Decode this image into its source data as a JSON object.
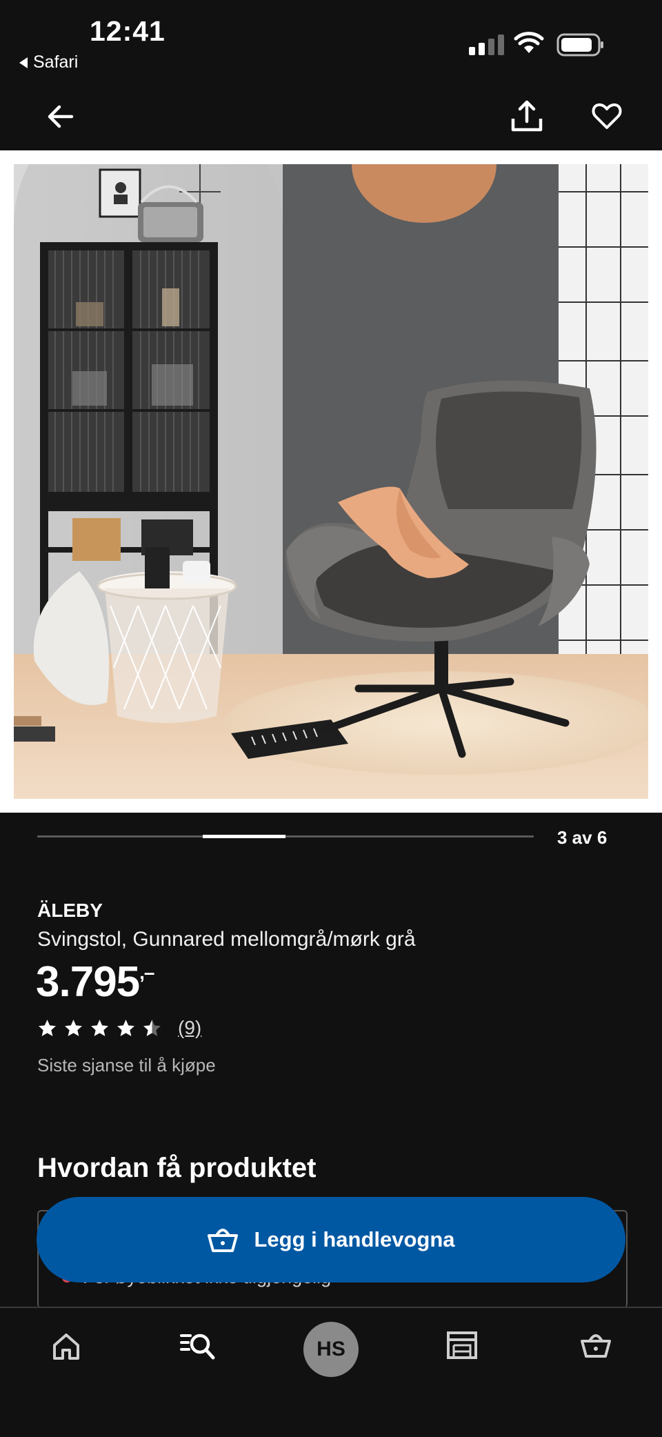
{
  "status_bar": {
    "time": "12:41",
    "back_app_label": "Safari"
  },
  "header": {
    "back_icon": "arrow-left-icon",
    "share_icon": "share-icon",
    "favorite_icon": "heart-icon"
  },
  "gallery": {
    "current_index": 3,
    "total": 6,
    "counter_text": "3 av 6",
    "progress_fraction": 0.5
  },
  "product": {
    "brand": "ÄLEBY",
    "description": "Svingstol, Gunnared mellomgrå/mørk grå",
    "price": "3.795",
    "price_suffix": ",–",
    "rating": 4.5,
    "rating_max": 5,
    "review_count_text": "(9)",
    "availability_note": "Siste sjanse til å kjøpe"
  },
  "availability": {
    "section_title": "Hvordan få produktet",
    "status_text": "For øyeblikket ikke tilgjengelig",
    "status_color": "#e0444e"
  },
  "cta": {
    "label": "Legg i handlevogna",
    "color": "#0058a3",
    "icon": "shopping-basket-icon"
  },
  "bottom_nav": {
    "items": [
      {
        "name": "home",
        "icon": "home-icon"
      },
      {
        "name": "search",
        "icon": "search-icon"
      },
      {
        "name": "profile",
        "label": "HS"
      },
      {
        "name": "stores",
        "icon": "store-icon"
      },
      {
        "name": "cart",
        "icon": "basket-icon"
      }
    ]
  }
}
